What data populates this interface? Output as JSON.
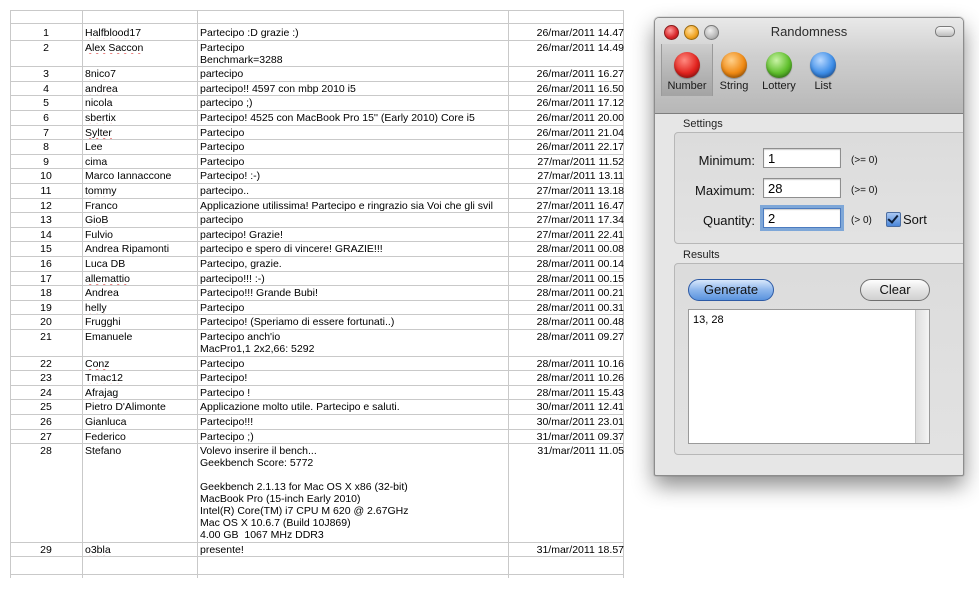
{
  "sheet": {
    "rows": [
      {
        "num": "1",
        "name": "Halfblood17",
        "msg": "Partecipo :D grazie :)",
        "date": "26/mar/2011 14.47"
      },
      {
        "num": "2",
        "name": "Alex Saccon",
        "msg": "Partecipo\nBenchmark=3288",
        "date": "26/mar/2011 14.49"
      },
      {
        "num": "3",
        "name": "8nico7",
        "msg": "partecipo",
        "date": "26/mar/2011 16.27"
      },
      {
        "num": "4",
        "name": "andrea",
        "msg": "partecipo!! 4597 con mbp 2010 i5",
        "date": "26/mar/2011 16.50"
      },
      {
        "num": "5",
        "name": "nicola",
        "msg": "partecipo ;)",
        "date": "26/mar/2011 17.12"
      },
      {
        "num": "6",
        "name": "sbertix",
        "msg": "Partecipo! 4525 con MacBook Pro 15'' (Early 2010) Core i5",
        "date": "26/mar/2011 20.00"
      },
      {
        "num": "7",
        "name": "Sylter",
        "msg": "Partecipo",
        "date": "26/mar/2011 21.04"
      },
      {
        "num": "8",
        "name": "Lee",
        "msg": "Partecipo",
        "date": "26/mar/2011 22.17"
      },
      {
        "num": "9",
        "name": "cima",
        "msg": "Partecipo",
        "date": "27/mar/2011 11.52"
      },
      {
        "num": "10",
        "name": "Marco Iannaccone",
        "msg": "Partecipo! :-)",
        "date": "27/mar/2011 13.11"
      },
      {
        "num": "11",
        "name": "tommy",
        "msg": "partecipo..",
        "date": "27/mar/2011 13.18"
      },
      {
        "num": "12",
        "name": "Franco",
        "msg": "Applicazione utilissima! Partecipo e ringrazio sia Voi che gli svil",
        "date": "27/mar/2011 16.47"
      },
      {
        "num": "13",
        "name": "GioB",
        "msg": "partecipo",
        "date": "27/mar/2011 17.34"
      },
      {
        "num": "14",
        "name": "Fulvio",
        "msg": "partecipo! Grazie!",
        "date": "27/mar/2011 22.41"
      },
      {
        "num": "15",
        "name": "Andrea Ripamonti",
        "msg": "partecipo e spero di vincere! GRAZIE!!!",
        "date": "28/mar/2011 00.08"
      },
      {
        "num": "16",
        "name": "Luca DB",
        "msg": "Partecipo, grazie.",
        "date": "28/mar/2011 00.14"
      },
      {
        "num": "17",
        "name": "allemattio",
        "msg": "partecipo!!! :-)",
        "date": "28/mar/2011 00.15"
      },
      {
        "num": "18",
        "name": "Andrea",
        "msg": "Partecipo!!! Grande Bubi!",
        "date": "28/mar/2011 00.21"
      },
      {
        "num": "19",
        "name": "helly",
        "msg": "Partecipo",
        "date": "28/mar/2011 00.31"
      },
      {
        "num": "20",
        "name": "Frugghi",
        "msg": "Partecipo! (Speriamo di essere fortunati..)",
        "date": "28/mar/2011 00.48"
      },
      {
        "num": "21",
        "name": "Emanuele",
        "msg": "Partecipo anch'io\nMacPro1,1 2x2,66: 5292",
        "date": "28/mar/2011 09.27"
      },
      {
        "num": "22",
        "name": "Conz",
        "msg": "Partecipo",
        "date": "28/mar/2011 10.16"
      },
      {
        "num": "23",
        "name": "Tmac12",
        "msg": "Partecipo!",
        "date": "28/mar/2011 10.26"
      },
      {
        "num": "24",
        "name": "Afrajag",
        "msg": "Partecipo !",
        "date": "28/mar/2011 15.43"
      },
      {
        "num": "25",
        "name": "Pietro D'Alimonte",
        "msg": "Applicazione molto utile. Partecipo e saluti.",
        "date": "30/mar/2011 12.41"
      },
      {
        "num": "26",
        "name": "Gianluca",
        "msg": "Partecipo!!!",
        "date": "30/mar/2011 23.01"
      },
      {
        "num": "27",
        "name": "Federico",
        "msg": "Partecipo ;)",
        "date": "31/mar/2011 09.37"
      },
      {
        "num": "28",
        "name": "Stefano",
        "msg": "Volevo inserire il bench...\nGeekbench Score: 5772\n\nGeekbench 2.1.13 for Mac OS X x86 (32-bit)\nMacBook Pro (15-inch Early 2010)\nIntel(R) Core(TM) i7 CPU M 620 @ 2.67GHz\nMac OS X 10.6.7 (Build 10J869)\n4.00 GB  1067 MHz DDR3",
        "date": "31/mar/2011 11.05"
      },
      {
        "num": "29",
        "name": "o3bla",
        "msg": "presente!",
        "date": "31/mar/2011 18.57"
      }
    ]
  },
  "window": {
    "title": "Randomness",
    "toolbar": [
      {
        "label": "Number",
        "color": "#e2241f"
      },
      {
        "label": "String",
        "color": "#f08a14"
      },
      {
        "label": "Lottery",
        "color": "#5fbf2c"
      },
      {
        "label": "List",
        "color": "#3e8ee8"
      }
    ],
    "settings": {
      "group_label": "Settings",
      "minimum_label": "Minimum:",
      "minimum_value": "1",
      "minimum_hint": "(>= 0)",
      "maximum_label": "Maximum:",
      "maximum_value": "28",
      "maximum_hint": "(>= 0)",
      "quantity_label": "Quantity:",
      "quantity_value": "2",
      "quantity_hint": "(> 0)",
      "sort_label": "Sort"
    },
    "results": {
      "group_label": "Results",
      "generate_label": "Generate",
      "clear_label": "Clear",
      "output": "13, 28"
    }
  }
}
